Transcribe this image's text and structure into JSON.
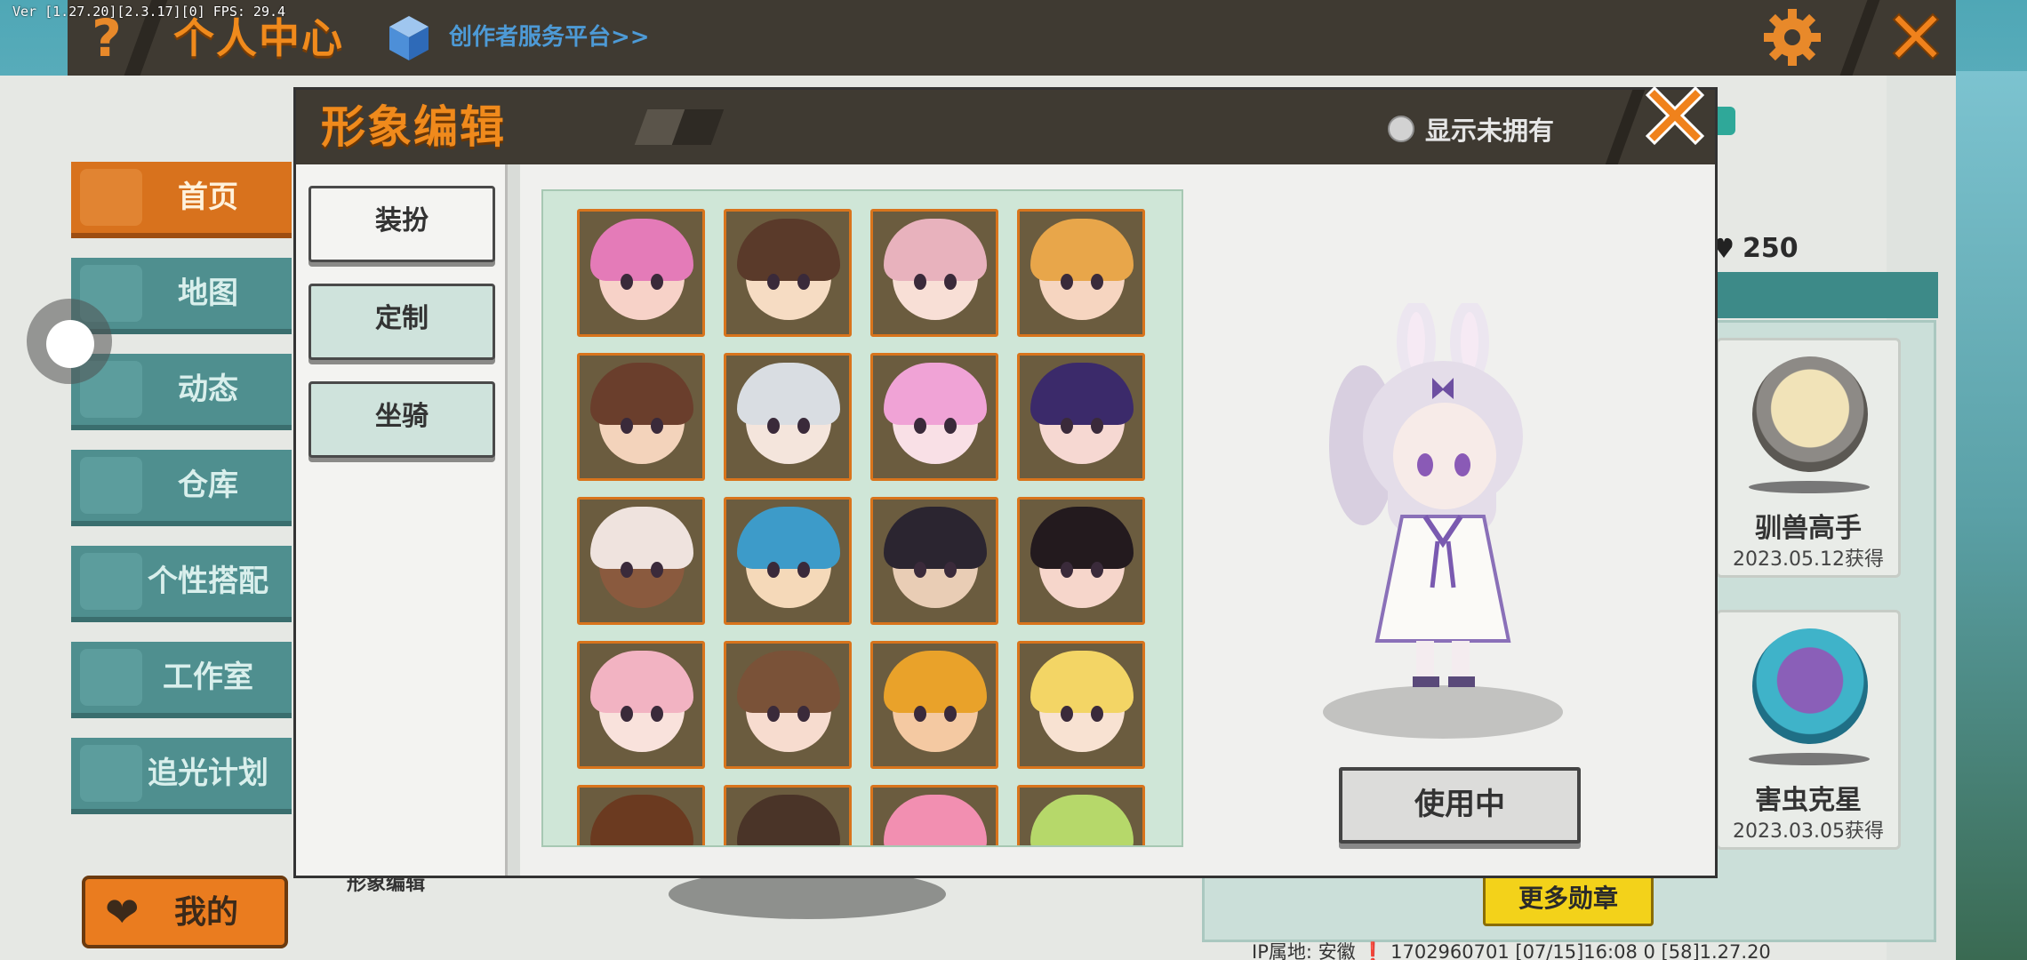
{
  "debug": {
    "version": "Ver [1.27.20][2.3.17][0] FPS: 29.4"
  },
  "topbar": {
    "title": "个人中心",
    "creator_link": "创作者服务平台>>",
    "help_icon": "question-icon",
    "settings_icon": "gear-icon",
    "close_icon": "close-icon"
  },
  "sidebar": {
    "items": [
      {
        "label": "首页",
        "icon": "house-icon",
        "active": true
      },
      {
        "label": "地图",
        "icon": "map-icon",
        "active": false
      },
      {
        "label": "动态",
        "icon": "bell-icon",
        "active": false
      },
      {
        "label": "仓库",
        "icon": "box-icon",
        "active": false
      },
      {
        "label": "个性搭配",
        "icon": "hanger-icon",
        "active": false
      },
      {
        "label": "工作室",
        "icon": "tree-icon",
        "active": false
      },
      {
        "label": "追光计划",
        "icon": "flag-icon",
        "active": false
      }
    ],
    "me_button": {
      "label": "我的",
      "icon": "heart-icon"
    }
  },
  "profile": {
    "coin_count": "250",
    "medals": [
      {
        "name": "驯兽高手",
        "date": "2023.05.12获得",
        "color": "#b7a58a"
      },
      {
        "name": "害虫克星",
        "date": "2023.03.05获得",
        "color": "#3fb3c9"
      }
    ],
    "more_medals_label": "更多勋章",
    "avatar_edit_label": "形象编辑",
    "footer_info": "IP属地: 安徽 ❗    1702960701    [07/15]16:08 0  [58]1.27.20"
  },
  "modal": {
    "title": "形象编辑",
    "show_unowned_label": "显示未拥有",
    "show_unowned_checked": false,
    "tabs": [
      {
        "label": "装扮",
        "active": true
      },
      {
        "label": "定制",
        "active": false
      },
      {
        "label": "坐骑",
        "active": false
      }
    ],
    "avatars": [
      {
        "hair": "#e47bb8",
        "face": "#f7d2c8"
      },
      {
        "hair": "#5a3a2a",
        "face": "#f6dcc3"
      },
      {
        "hair": "#e8b2bd",
        "face": "#f8dfd6"
      },
      {
        "hair": "#e8a64a",
        "face": "#f6d5c0"
      },
      {
        "hair": "#6a3e2c",
        "face": "#f3d3bb"
      },
      {
        "hair": "#d9dde2",
        "face": "#f4e5dc"
      },
      {
        "hair": "#f0a3d6",
        "face": "#f9e0e6"
      },
      {
        "hair": "#3b2a6a",
        "face": "#f6d8d2"
      },
      {
        "hair": "#efe3de",
        "face": "#8a5a3e"
      },
      {
        "hair": "#3d9bc9",
        "face": "#f5d9b9"
      },
      {
        "hair": "#2b2530",
        "face": "#e9cdb5"
      },
      {
        "hair": "#231a1e",
        "face": "#f6d6cb"
      },
      {
        "hair": "#f2b3c2",
        "face": "#f9e2dc"
      },
      {
        "hair": "#7a5238",
        "face": "#f7dccf"
      },
      {
        "hair": "#e9a22a",
        "face": "#f4c9a2"
      },
      {
        "hair": "#f3d565",
        "face": "#f8e2d2"
      },
      {
        "hair": "#6b3a20",
        "face": "#f1c9a6"
      },
      {
        "hair": "#4a3428",
        "face": "#f0cfb3"
      },
      {
        "hair": "#f28fb1",
        "face": "#f8dad8"
      },
      {
        "hair": "#b6d86a",
        "face": "#e9f0c8"
      }
    ],
    "use_button_label": "使用中"
  }
}
